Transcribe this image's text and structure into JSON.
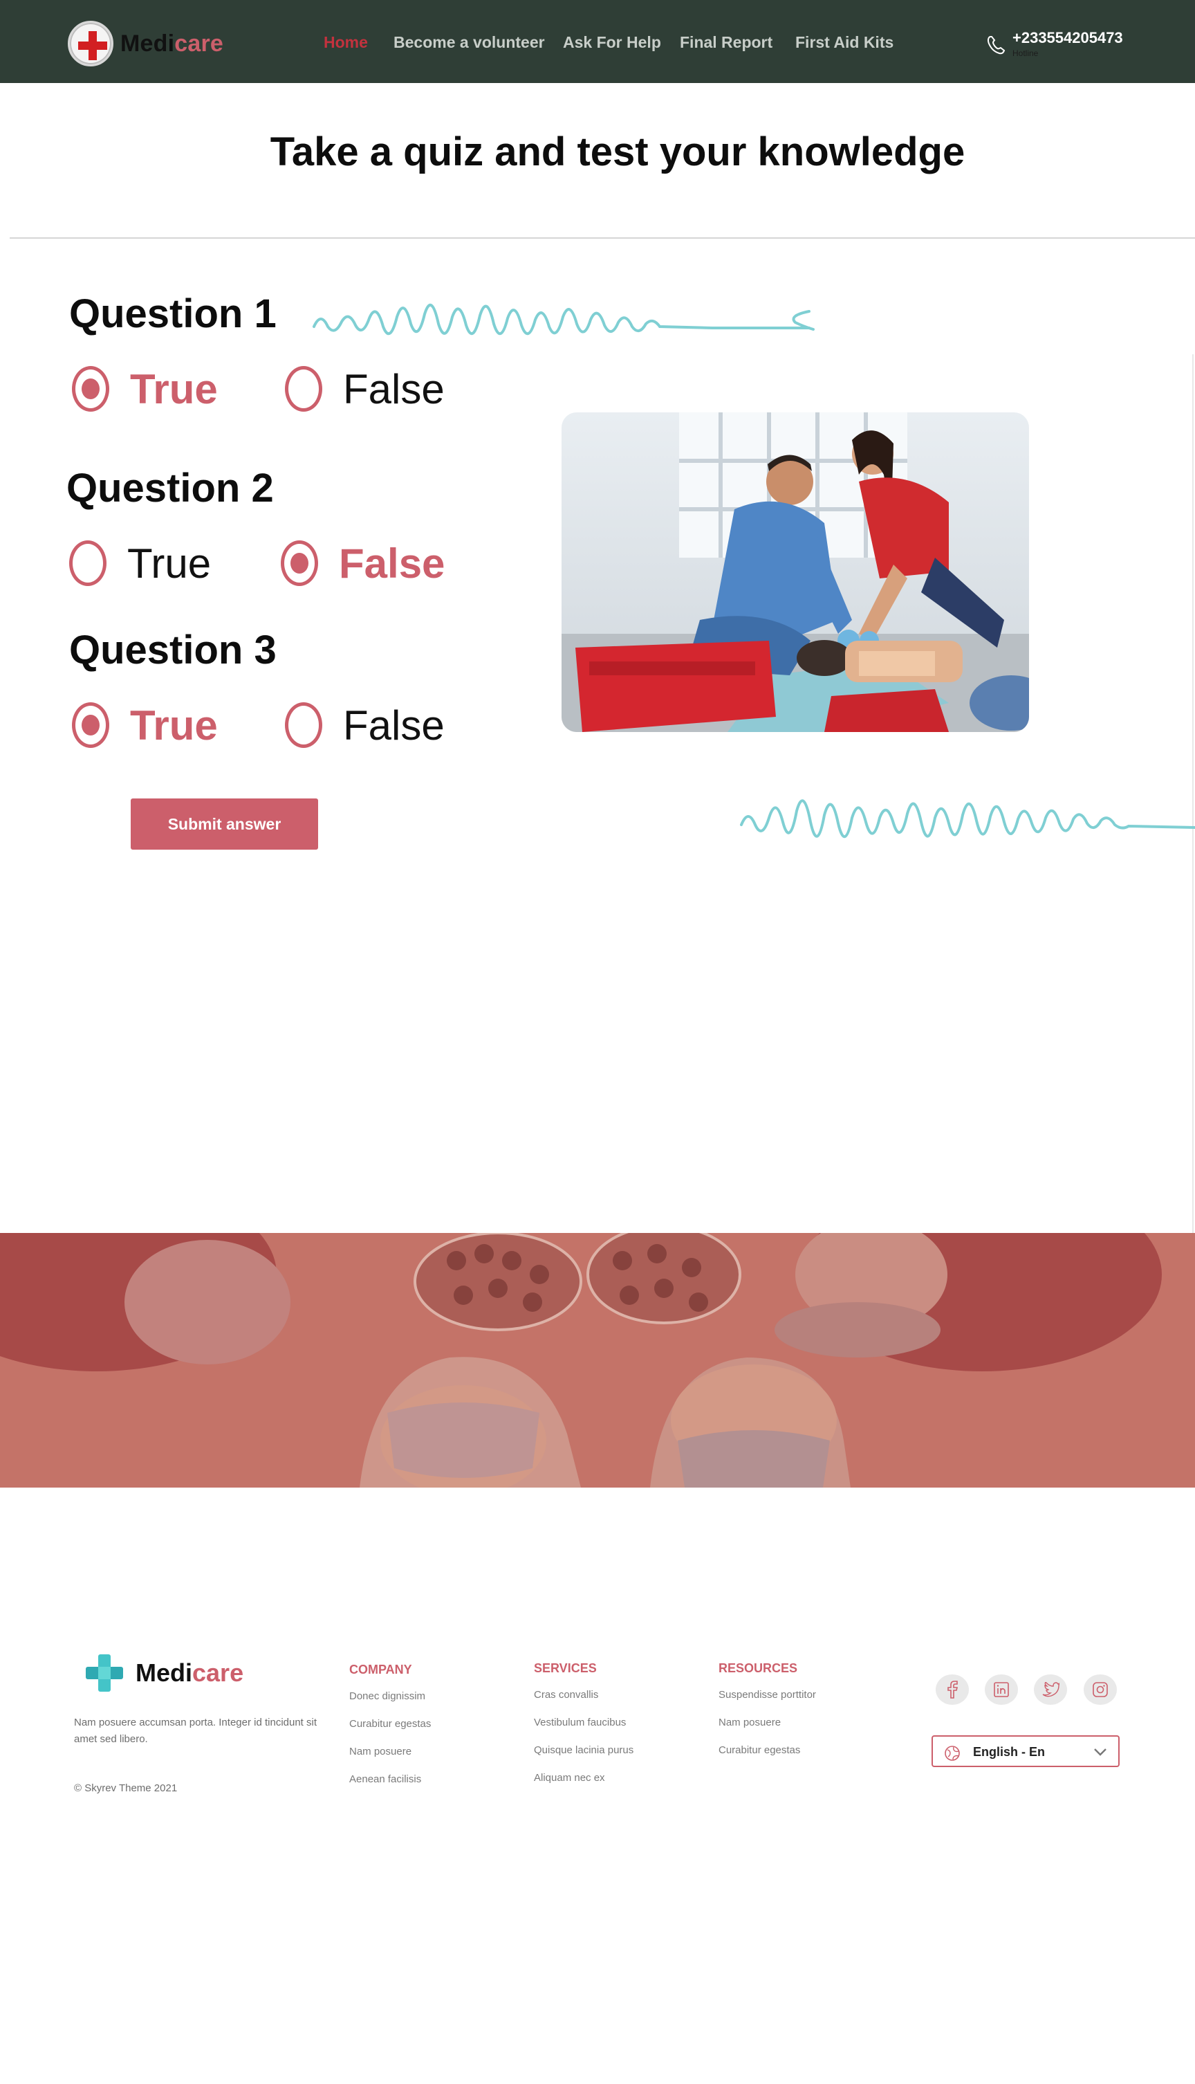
{
  "header": {
    "logo": {
      "part1": "Medi",
      "part2": "care"
    },
    "nav": [
      {
        "label": "Home",
        "active": true
      },
      {
        "label": "Become a volunteer",
        "active": false
      },
      {
        "label": "Ask For Help",
        "active": false
      },
      {
        "label": "Final Report",
        "active": false
      },
      {
        "label": "First Aid Kits",
        "active": false
      }
    ],
    "phone": {
      "number": "+233554205473",
      "sub": "Hotline"
    },
    "colors": {
      "background": "#2f3e36",
      "accent": "#cc5f6b",
      "active_nav": "#c3323e"
    }
  },
  "main": {
    "title": "Take a quiz and test your knowledge",
    "questions": [
      {
        "label": "Question 1",
        "options": [
          "True",
          "False"
        ],
        "selected": "True"
      },
      {
        "label": "Question 2",
        "options": [
          "True",
          "False"
        ],
        "selected": "False"
      },
      {
        "label": "Question 3",
        "options": [
          "True",
          "False"
        ],
        "selected": "True"
      }
    ],
    "submit_label": "Submit answer"
  },
  "footer": {
    "logo": {
      "part1": "Medi",
      "part2": "care"
    },
    "description": "Nam posuere accumsan porta. Integer id tincidunt sit amet sed libero.",
    "copyright": "© Skyrev Theme 2021",
    "columns": [
      {
        "heading": "COMPANY",
        "links": [
          "Donec dignissim",
          "Curabitur egestas",
          "Nam posuere",
          "Aenean facilisis"
        ]
      },
      {
        "heading": "SERVICES",
        "links": [
          "Cras convallis",
          "Vestibulum faucibus",
          "Quisque lacinia purus",
          "Aliquam nec ex"
        ]
      },
      {
        "heading": "RESOURCES",
        "links": [
          "Suspendisse porttitor",
          "Nam posuere",
          "Curabitur egestas"
        ]
      }
    ],
    "social_icons": [
      "facebook-icon",
      "linkedin-icon",
      "twitter-icon",
      "instagram-icon"
    ],
    "language": "English - En"
  }
}
